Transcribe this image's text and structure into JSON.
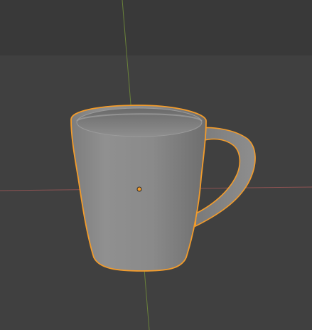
{
  "viewport": {
    "mode": "Object Mode",
    "shading": "solid",
    "selected_object": "",
    "colors": {
      "background_far": "#393939",
      "background_floor": "#404040",
      "x_axis": "#b35a5a",
      "y_axis": "#8aa04a",
      "selection_outline": "#f39c2b",
      "object_color": "#8c8c8c",
      "origin_dot": "#f39c2b"
    },
    "icons": {
      "origin": "object-origin-icon"
    }
  }
}
